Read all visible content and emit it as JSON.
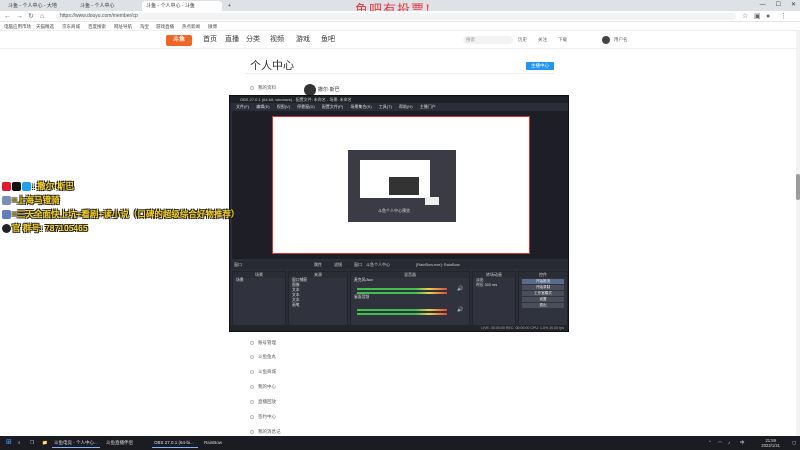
{
  "browser": {
    "tabs": [
      {
        "label": "斗鱼 - 个人中心 - 大地"
      },
      {
        "label": "斗鱼 - 个人中心"
      },
      {
        "label": "斗鱼 - 个人中心 - 斗鱼"
      }
    ],
    "url": "https://www.douyu.com/member/cp",
    "bookmarks": [
      "电脑应用市场",
      "天猫精选",
      "京东商城",
      "百度搜索",
      "网址导航",
      "淘宝",
      "游戏直播",
      "热点新闻",
      "微博"
    ],
    "banner": "鱼吧有投票!"
  },
  "site": {
    "logo": "斗鱼",
    "nav": [
      "首页",
      "直播",
      "分类",
      "视频",
      "游戏",
      "鱼吧"
    ],
    "search_placeholder": "搜索",
    "header_icons": [
      "历史",
      "关注",
      "下载"
    ],
    "username": "用户名"
  },
  "page": {
    "title": "个人中心",
    "upload_label": "主播中心",
    "profile_name": "撒尔·斯巴",
    "menu_items": [
      "我的资料",
      "账号管理",
      "斗鱼鱼丸",
      "斗鱼商城",
      "我的中心",
      "直播回放",
      "签约中心",
      "我的消息记"
    ]
  },
  "obs": {
    "title": "OBS 27.0.1 (64-bit, windows) - 配置文件: 未命名 - 场景: 未命名",
    "menu": [
      "文件(F)",
      "编辑(E)",
      "视图(V)",
      "停靠窗(D)",
      "配置文件(P)",
      "场景集合(S)",
      "工具(T)",
      "帮助(H)",
      "主播门户"
    ],
    "preview_caption": "斗鱼个人中心预览",
    "scene_bar": [
      "窗口",
      "属性",
      "滤镜",
      "窗口",
      "斗鱼个人中心",
      "[RainBow.exe]: RainBow"
    ],
    "docks": {
      "scenes": {
        "header": "场景",
        "items": [
          "场景"
        ]
      },
      "sources": {
        "header": "来源",
        "items": [
          "窗口捕获",
          "图像",
          "文本",
          "文本",
          "文本",
          "画笔"
        ]
      },
      "mixer": {
        "header": "混音器",
        "items": [
          "麦克风/Aux",
          "桌面音频"
        ]
      },
      "transitions": {
        "header": "转场动画",
        "items": [
          "淡出",
          "时长 300 ms"
        ]
      },
      "controls": {
        "header": "控件",
        "items": [
          "开始推流",
          "开始录制",
          "工作室模式",
          "设置",
          "退出"
        ]
      }
    },
    "status": "LIVE: 00:00:00  REC: 00:00:00  CPU: 1.5%  30.00 fps"
  },
  "overlay": {
    "line1": ": 撒尔·斯巴",
    "line2": "=上海马镫骑",
    "line3": "=三天全面快上坑+看剧+读小说（口碑的超级综合好物推荐）",
    "line4": "官 群号: 787105465"
  },
  "taskbar": {
    "items": [
      "斗鱼电竞 - 个人中心...",
      "斗鱼直播伴侣",
      "OBS 27.0.1 (64-bi...",
      "RainBow"
    ],
    "time": "21:59",
    "date": "2022/1/21"
  },
  "colors": {
    "banner": "#e23b3b",
    "brand": "#f26522",
    "overlay_text": "#f7d21e",
    "accent": "#2196f3"
  }
}
